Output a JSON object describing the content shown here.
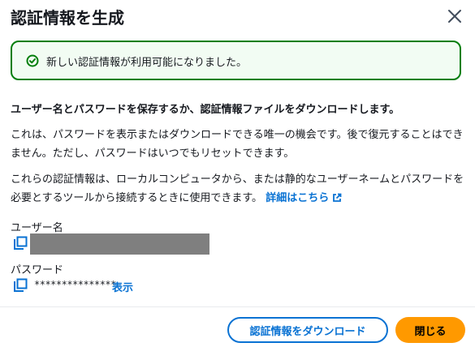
{
  "dialog": {
    "title": "認証情報を生成",
    "close_icon": "close-icon"
  },
  "alert": {
    "type": "success",
    "icon": "check-circle-icon",
    "color": "#037f0c",
    "message": "新しい認証情報が利用可能になりました。"
  },
  "content": {
    "heading": "ユーザー名とパスワードを保存するか、認証情報ファイルをダウンロードします。",
    "paragraph1": "これは、パスワードを表示またはダウンロードできる唯一の機会です。後で復元することはできません。ただし、パスワードはいつでもリセットできます。",
    "paragraph2": "これらの認証情報は、ローカルコンピュータから、または静的なユーザーネームとパスワードを必要とするツールから接続するときに使用できます。",
    "details_link": "詳細はこちら",
    "details_link_icon": "external-link-icon"
  },
  "credentials": {
    "username_label": "ユーザー名",
    "password_label": "パスワード",
    "password_masked": "***************",
    "show_label": "表示",
    "copy_icon": "copy-icon"
  },
  "footer": {
    "download_button": "認証情報をダウンロード",
    "close_button": "閉じる",
    "accent_color": "#0972d3",
    "primary_color": "#ff9900"
  }
}
